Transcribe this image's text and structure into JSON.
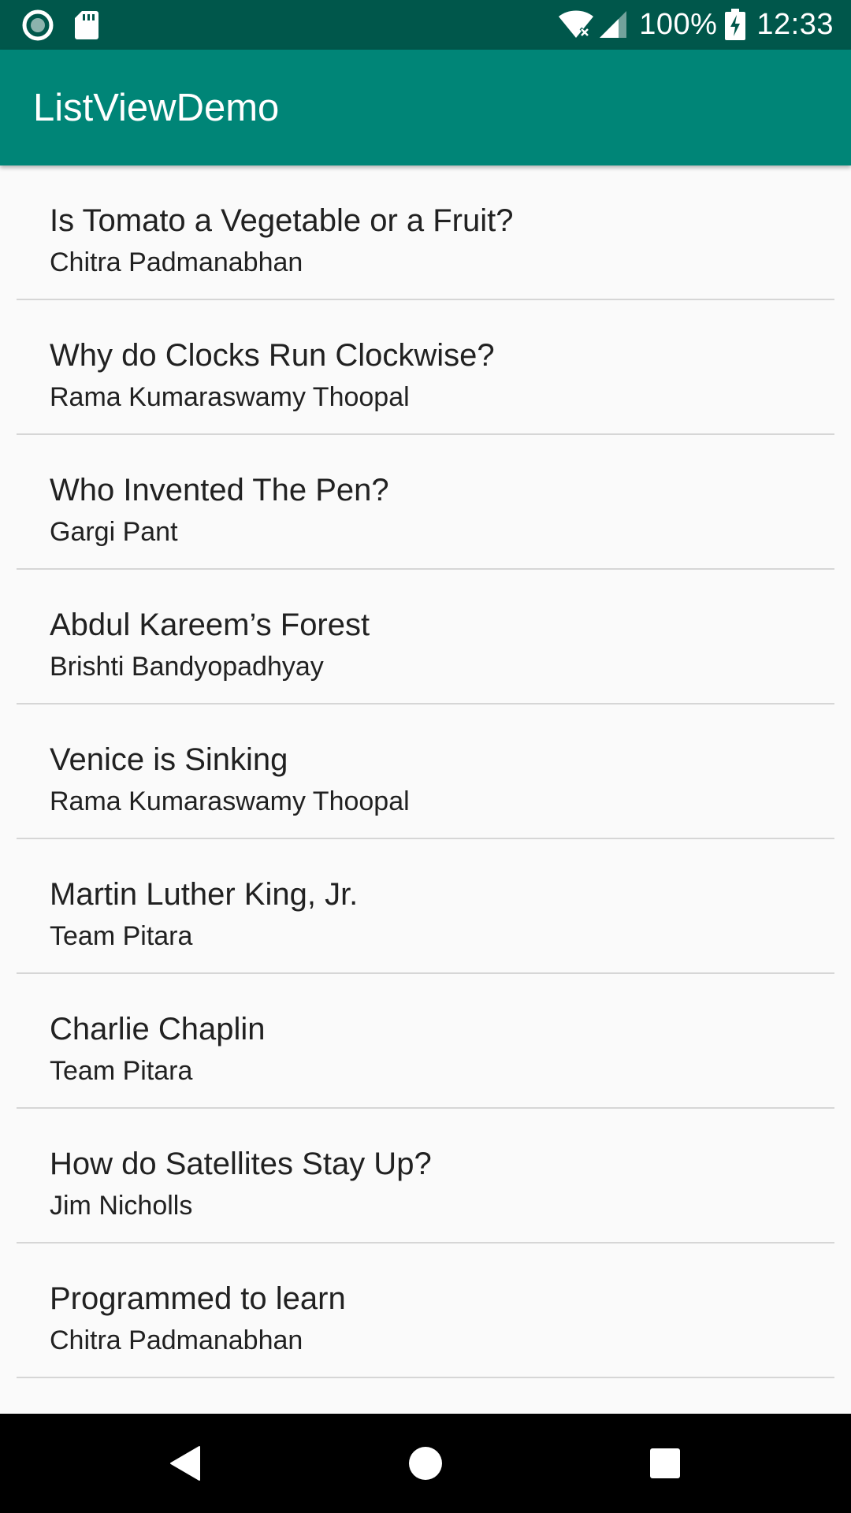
{
  "status_bar": {
    "battery_percent": "100%",
    "time": "12:33",
    "icons": [
      "notification-circle-icon",
      "sd-card-icon",
      "wifi-icon",
      "cell-signal-icon",
      "battery-charging-icon"
    ]
  },
  "app_bar": {
    "title": "ListViewDemo",
    "background_color": "#008577",
    "status_bar_color": "#00574b"
  },
  "list": {
    "items": [
      {
        "title": "Is Tomato a Vegetable or a Fruit?",
        "author": "Chitra Padmanabhan"
      },
      {
        "title": "Why do Clocks Run Clockwise?",
        "author": "Rama Kumaraswamy Thoopal"
      },
      {
        "title": "Who Invented The Pen?",
        "author": "Gargi Pant"
      },
      {
        "title": "Abdul Kareem’s Forest",
        "author": "Brishti Bandyopadhyay"
      },
      {
        "title": "Venice is Sinking",
        "author": "Rama Kumaraswamy Thoopal"
      },
      {
        "title": "Martin Luther King, Jr.",
        "author": "Team Pitara"
      },
      {
        "title": "Charlie Chaplin",
        "author": "Team Pitara"
      },
      {
        "title": "How do Satellites Stay Up?",
        "author": "Jim Nicholls"
      },
      {
        "title": "Programmed to learn",
        "author": "Chitra Padmanabhan"
      }
    ]
  },
  "nav_bar": {
    "buttons": [
      "back-icon",
      "home-icon",
      "recent-apps-icon"
    ]
  }
}
